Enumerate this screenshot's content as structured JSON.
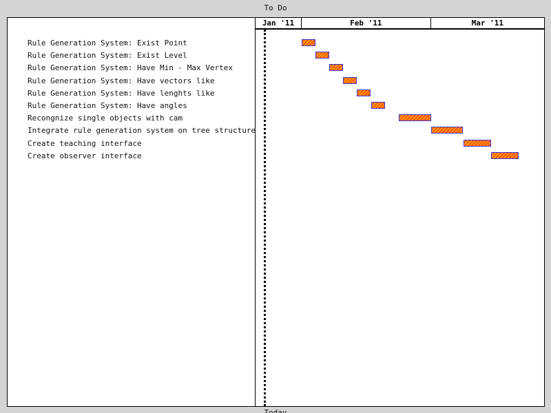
{
  "window": {
    "title": "To Do",
    "bottom_label": "Today"
  },
  "chart_data": {
    "type": "gantt",
    "months": [
      {
        "label": "Jan '11"
      },
      {
        "label": "Feb '11"
      },
      {
        "label": "Mar '11"
      }
    ],
    "today_marker": "2011-01-24",
    "tasks": [
      {
        "name": "Rule Generation System: Exist Point",
        "start": "2011-02-01",
        "end": "2011-02-04"
      },
      {
        "name": "Rule Generation System: Exist Level",
        "start": "2011-02-04",
        "end": "2011-02-07"
      },
      {
        "name": "Rule Generation System: Have Min - Max Vertex",
        "start": "2011-02-07",
        "end": "2011-02-10"
      },
      {
        "name": "Rule Generation System: Have vectors like",
        "start": "2011-02-10",
        "end": "2011-02-13"
      },
      {
        "name": "Rule Generation System: Have lenghts like",
        "start": "2011-02-13",
        "end": "2011-02-16"
      },
      {
        "name": "Rule Generation System: Have angles",
        "start": "2011-02-16",
        "end": "2011-02-19"
      },
      {
        "name": "Recongnize single objects with cam",
        "start": "2011-02-22",
        "end": "2011-03-01"
      },
      {
        "name": "Integrate rule generation system on tree structure",
        "start": "2011-03-01",
        "end": "2011-03-08"
      },
      {
        "name": "Create teaching interface",
        "start": "2011-03-08",
        "end": "2011-03-14"
      },
      {
        "name": "Create observer interface",
        "start": "2011-03-14",
        "end": "2011-03-20"
      }
    ]
  },
  "colors": {
    "bar_fill": "#ff5a1f",
    "bar_hatch": "#ffb000",
    "bar_border": "#3b2fd6",
    "background": "#d4d4d4",
    "panel": "#ffffff"
  }
}
